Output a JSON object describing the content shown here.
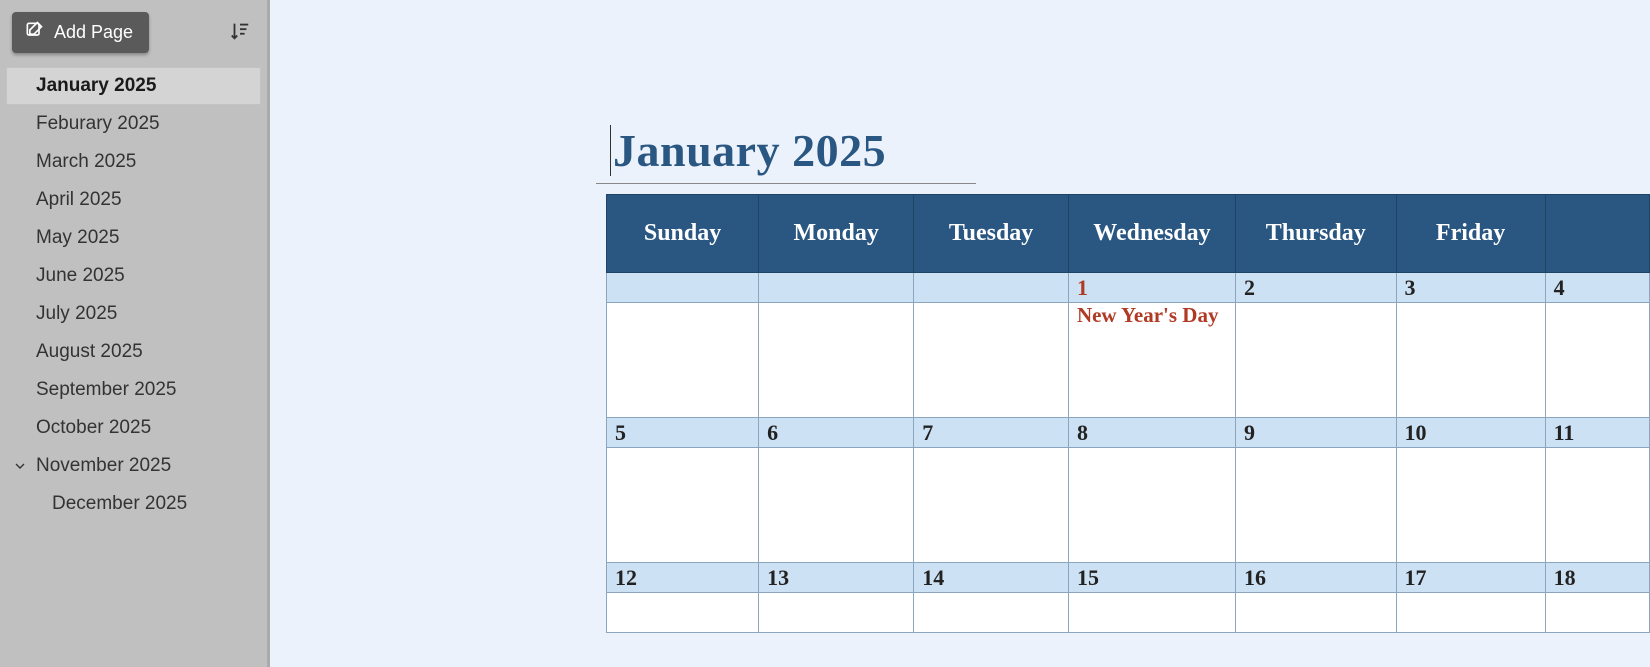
{
  "sidebar": {
    "add_page_label": "Add Page",
    "pages": [
      {
        "label": "January 2025",
        "selected": true,
        "expandable": false,
        "child": false
      },
      {
        "label": "Feburary 2025",
        "selected": false,
        "expandable": false,
        "child": false
      },
      {
        "label": "March 2025",
        "selected": false,
        "expandable": false,
        "child": false
      },
      {
        "label": "April 2025",
        "selected": false,
        "expandable": false,
        "child": false
      },
      {
        "label": "May 2025",
        "selected": false,
        "expandable": false,
        "child": false
      },
      {
        "label": "June 2025",
        "selected": false,
        "expandable": false,
        "child": false
      },
      {
        "label": "July 2025",
        "selected": false,
        "expandable": false,
        "child": false
      },
      {
        "label": "August 2025",
        "selected": false,
        "expandable": false,
        "child": false
      },
      {
        "label": "September 2025",
        "selected": false,
        "expandable": false,
        "child": false
      },
      {
        "label": "October 2025",
        "selected": false,
        "expandable": false,
        "child": false
      },
      {
        "label": "November 2025",
        "selected": false,
        "expandable": true,
        "child": false
      },
      {
        "label": "December 2025",
        "selected": false,
        "expandable": false,
        "child": true
      }
    ]
  },
  "main": {
    "title": "January 2025",
    "days_of_week": [
      "Sunday",
      "Monday",
      "Tuesday",
      "Wednesday",
      "Thursday",
      "Friday",
      ""
    ],
    "weeks": [
      {
        "nums": [
          "",
          "",
          "",
          "1",
          "2",
          "3",
          "4"
        ],
        "holiday": [
          false,
          false,
          false,
          true,
          false,
          false,
          false
        ],
        "events": [
          "",
          "",
          "",
          "New Year's Day",
          "",
          "",
          ""
        ]
      },
      {
        "nums": [
          "5",
          "6",
          "7",
          "8",
          "9",
          "10",
          "11"
        ],
        "holiday": [
          false,
          false,
          false,
          false,
          false,
          false,
          false
        ],
        "events": [
          "",
          "",
          "",
          "",
          "",
          "",
          ""
        ]
      },
      {
        "nums": [
          "12",
          "13",
          "14",
          "15",
          "16",
          "17",
          "18"
        ],
        "holiday": [
          false,
          false,
          false,
          false,
          false,
          false,
          false
        ],
        "events": [
          "",
          "",
          "",
          "",
          "",
          "",
          ""
        ]
      }
    ]
  }
}
